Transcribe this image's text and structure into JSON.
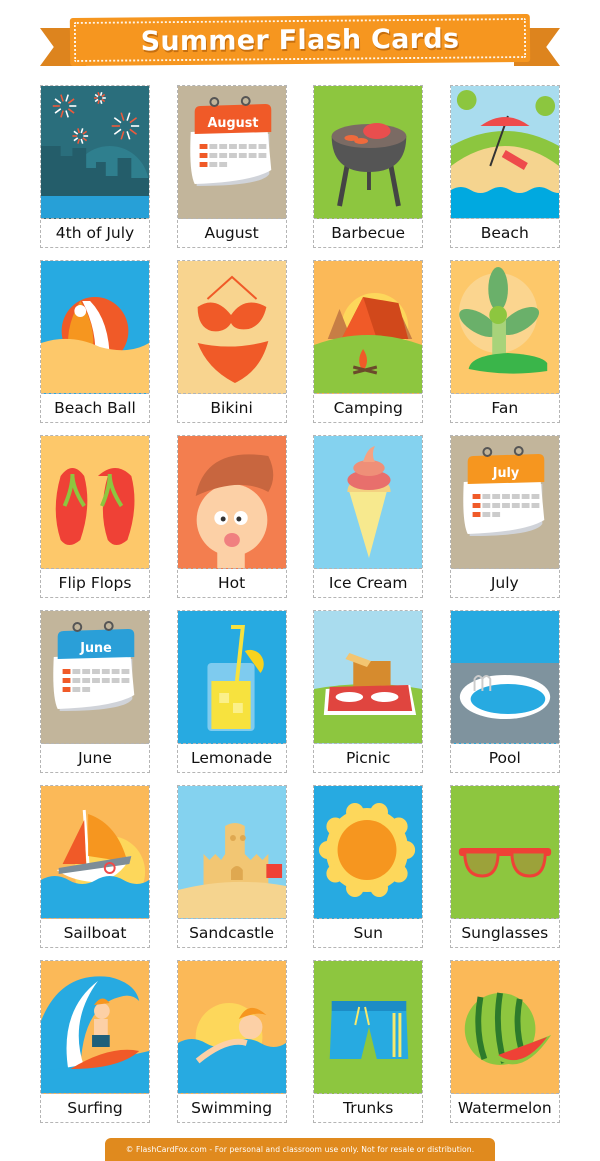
{
  "header": {
    "title": "Summer Flash Cards"
  },
  "colors": {
    "ribbon": "#f6961f",
    "ribbon_tail": "#dd841e",
    "footer": "#e08a1e"
  },
  "cards": [
    {
      "label": "4th of July",
      "icon": "fireworks-icon",
      "bg": "#2a6e7c"
    },
    {
      "label": "August",
      "icon": "calendar-icon",
      "bg": "#c2b59b",
      "calendar_title": "August",
      "calendar_color": "#f05a28"
    },
    {
      "label": "Barbecue",
      "icon": "grill-icon",
      "bg": "#8dc63f"
    },
    {
      "label": "Beach",
      "icon": "beach-umbrella-icon",
      "bg": "#a9dcee"
    },
    {
      "label": "Beach Ball",
      "icon": "beach-ball-icon",
      "bg": "#27aae1"
    },
    {
      "label": "Bikini",
      "icon": "bikini-icon",
      "bg": "#f8d48f"
    },
    {
      "label": "Camping",
      "icon": "tent-icon",
      "bg": "#fbb958"
    },
    {
      "label": "Fan",
      "icon": "fan-icon",
      "bg": "#fdc86a"
    },
    {
      "label": "Flip Flops",
      "icon": "flip-flops-icon",
      "bg": "#fdc86a"
    },
    {
      "label": "Hot",
      "icon": "sweating-face-icon",
      "bg": "#f37e4f"
    },
    {
      "label": "Ice Cream",
      "icon": "ice-cream-icon",
      "bg": "#84d2ef"
    },
    {
      "label": "July",
      "icon": "calendar-icon",
      "bg": "#c2b59b",
      "calendar_title": "July",
      "calendar_color": "#f6961f"
    },
    {
      "label": "June",
      "icon": "calendar-icon",
      "bg": "#c2b59b",
      "calendar_title": "June",
      "calendar_color": "#2a9fd8"
    },
    {
      "label": "Lemonade",
      "icon": "lemonade-icon",
      "bg": "#27aae1"
    },
    {
      "label": "Picnic",
      "icon": "picnic-basket-icon",
      "bg": "#a9dcee"
    },
    {
      "label": "Pool",
      "icon": "pool-icon",
      "bg": "#27aae1"
    },
    {
      "label": "Sailboat",
      "icon": "sailboat-icon",
      "bg": "#fbb958"
    },
    {
      "label": "Sandcastle",
      "icon": "sandcastle-icon",
      "bg": "#84d2ef"
    },
    {
      "label": "Sun",
      "icon": "sun-icon",
      "bg": "#27aae1"
    },
    {
      "label": "Sunglasses",
      "icon": "sunglasses-icon",
      "bg": "#8dc63f"
    },
    {
      "label": "Surfing",
      "icon": "surfer-icon",
      "bg": "#fbb958"
    },
    {
      "label": "Swimming",
      "icon": "swimmer-icon",
      "bg": "#fbb958"
    },
    {
      "label": "Trunks",
      "icon": "swim-trunks-icon",
      "bg": "#8dc63f"
    },
    {
      "label": "Watermelon",
      "icon": "watermelon-icon",
      "bg": "#fbb958"
    }
  ],
  "footer": {
    "text": "© FlashCardFox.com - For personal and classroom use only. Not for resale or distribution."
  }
}
